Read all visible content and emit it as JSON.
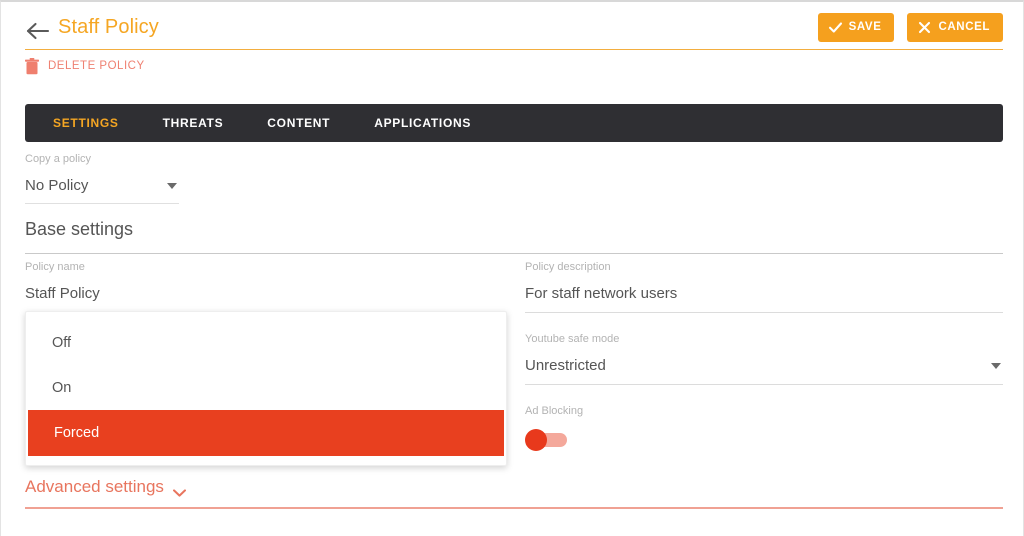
{
  "header": {
    "back_icon": "arrow-left-icon",
    "title": "Staff Policy",
    "save_label": "SAVE",
    "save_icon": "check-icon",
    "cancel_label": "CANCEL",
    "cancel_icon": "close-icon",
    "accent_color": "#f5a623",
    "button_color": "#f5a01e"
  },
  "delete": {
    "label": "DELETE POLICY",
    "icon": "trash-icon",
    "color": "#ef8172"
  },
  "tabs": [
    {
      "label": "SETTINGS",
      "active": true
    },
    {
      "label": "THREATS",
      "active": false
    },
    {
      "label": "CONTENT",
      "active": false
    },
    {
      "label": "APPLICATIONS",
      "active": false
    }
  ],
  "copy_policy": {
    "label": "Copy a policy",
    "value": "No Policy",
    "caret_icon": "caret-down-icon"
  },
  "base_settings": {
    "title": "Base settings",
    "policy_name": {
      "label": "Policy name",
      "value": "Staff Policy"
    },
    "policy_description": {
      "label": "Policy description",
      "value": "For staff network users"
    },
    "youtube_safe_mode": {
      "label": "Youtube safe mode",
      "value": "Unrestricted",
      "caret_icon": "caret-down-icon"
    },
    "ad_blocking": {
      "label": "Ad Blocking",
      "state": "off",
      "thumb_color": "#e8391c",
      "track_color": "#f4a89b"
    }
  },
  "dropdown": {
    "open": true,
    "options": [
      {
        "label": "Off",
        "selected": false
      },
      {
        "label": "On",
        "selected": false
      },
      {
        "label": "Forced",
        "selected": true
      }
    ],
    "selected_color": "#e8401f"
  },
  "advanced": {
    "label": "Advanced settings",
    "chevron_icon": "chevron-down-icon",
    "color": "#e8755e"
  }
}
